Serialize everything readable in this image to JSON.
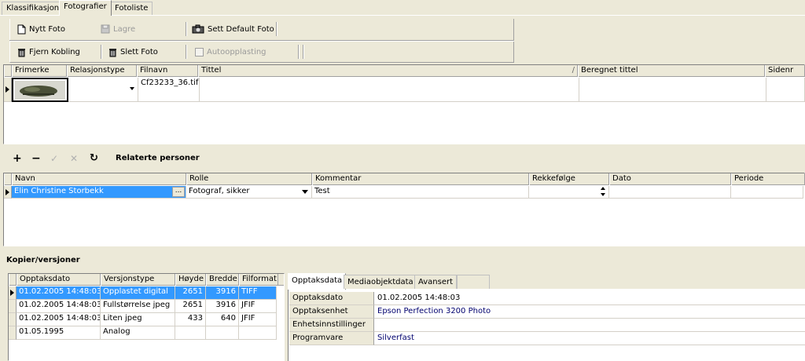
{
  "tabs": [
    {
      "label": "Klassifikasjon",
      "active": false
    },
    {
      "label": "Fotografier",
      "active": true
    },
    {
      "label": "Fotoliste",
      "active": false
    }
  ],
  "toolbar": {
    "new_photo": "Nytt Foto",
    "save": "Lagre",
    "set_default": "Sett Default Foto",
    "remove_link": "Fjern Kobling",
    "delete_photo": "Slett Foto",
    "autoupload": "Autoopplasting"
  },
  "photos": {
    "columns": [
      "Frimerke",
      "Relasjonstype",
      "Filnavn",
      "Tittel",
      "Beregnet tittel",
      "Sidenr"
    ],
    "sort_marker": "/",
    "rows": [
      {
        "relation": "",
        "filename": "Cf23233_36.tif",
        "title": "",
        "computed_title": "",
        "page": ""
      }
    ]
  },
  "persons": {
    "toolbar_title": "Relaterte personer",
    "columns": [
      "Navn",
      "Rolle",
      "Kommentar",
      "Rekkefølge",
      "Dato",
      "Periode"
    ],
    "rows": [
      {
        "name": "Elin Christine Storbekk",
        "role": "Fotograf, sikker",
        "comment": "Test",
        "order": "",
        "date": "",
        "period": ""
      }
    ],
    "ellipsis": "..."
  },
  "copies": {
    "title": "Kopier/versjoner",
    "columns": [
      "Opptaksdato",
      "Versjonstype",
      "Høyde",
      "Bredde",
      "Filformat"
    ],
    "rows": [
      {
        "date": "01.02.2005 14:48:03",
        "type": "Opplastet digital",
        "height": "2651",
        "width": "3916",
        "format": "TIFF",
        "selected": true
      },
      {
        "date": "01.02.2005 14:48:03",
        "type": "Fullstørrelse jpeg",
        "height": "2651",
        "width": "3916",
        "format": "JFIF",
        "selected": false
      },
      {
        "date": "01.02.2005 14:48:03",
        "type": "Liten jpeg",
        "height": "433",
        "width": "640",
        "format": "JFIF",
        "selected": false
      },
      {
        "date": "01.05.1995",
        "type": "Analog",
        "height": "",
        "width": "",
        "format": "",
        "selected": false
      }
    ]
  },
  "details": {
    "tabs": [
      "Opptaksdata",
      "Mediaobjektdata",
      "Avansert"
    ],
    "properties": [
      {
        "key": "Opptaksdato",
        "value": "01.02.2005 14:48:03"
      },
      {
        "key": "Opptaksenhet",
        "value": "Epson Perfection 3200 Photo"
      },
      {
        "key": "Enhetsinnstillinger",
        "value": ""
      },
      {
        "key": "Programvare",
        "value": "Silverfast"
      }
    ]
  },
  "colors": {
    "selection": "#3399ff",
    "face": "#ece9d8",
    "value_text": "#00006e"
  }
}
